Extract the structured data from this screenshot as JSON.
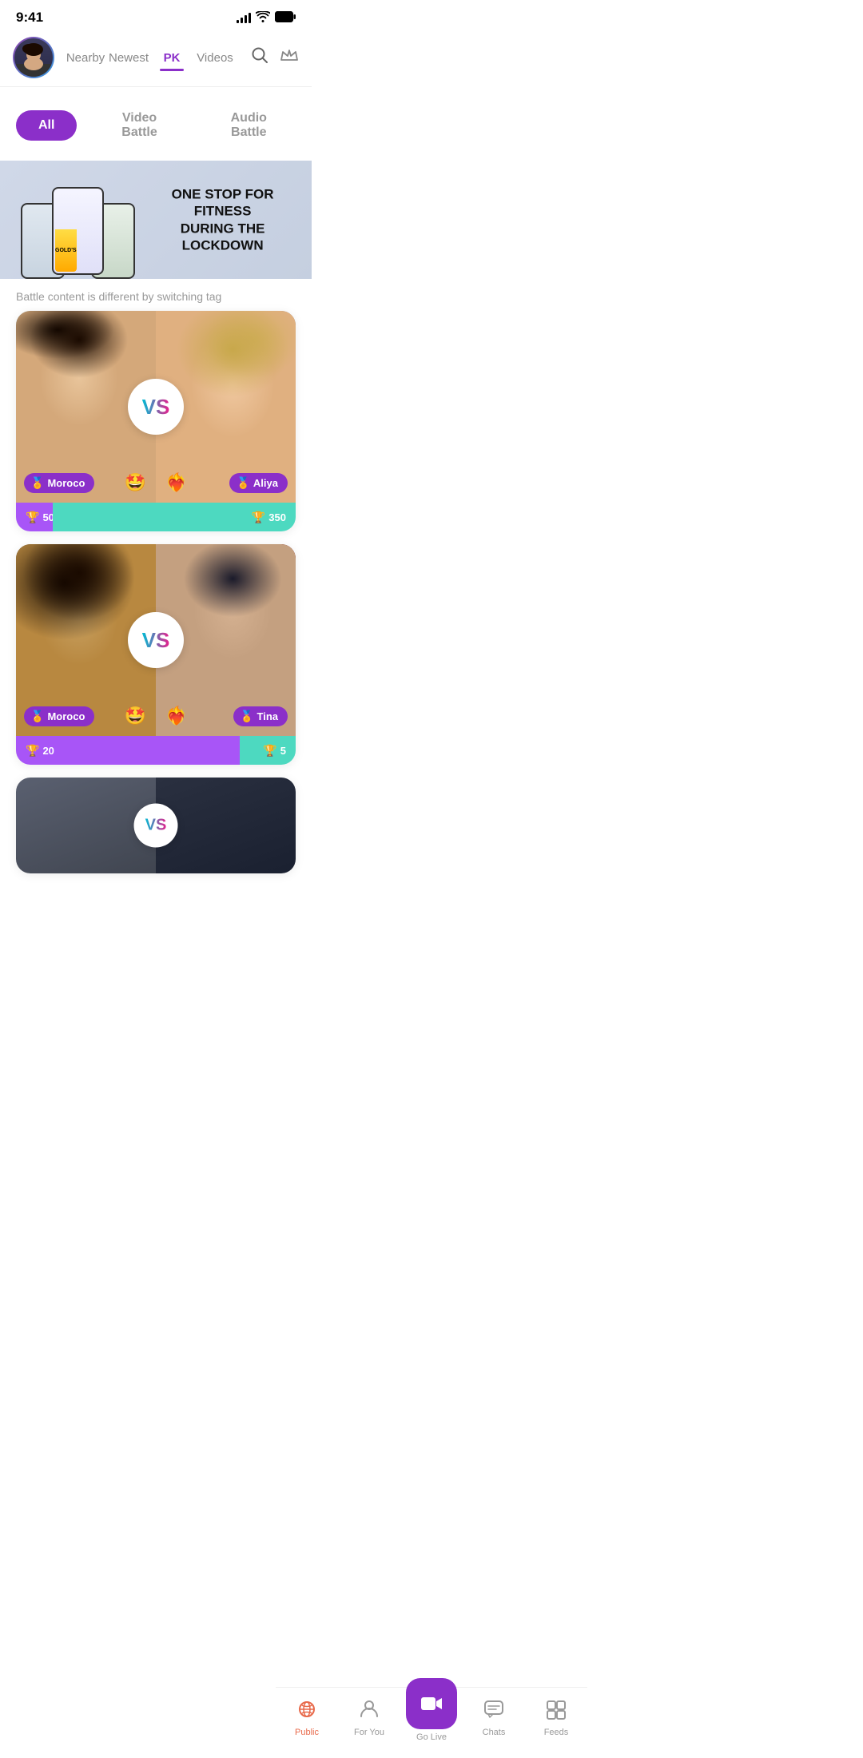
{
  "statusBar": {
    "time": "9:41"
  },
  "header": {
    "navItems": [
      {
        "id": "nearby",
        "label": "Nearby",
        "active": false
      },
      {
        "id": "newest",
        "label": "Newest",
        "active": false
      },
      {
        "id": "pk",
        "label": "PK",
        "active": true
      },
      {
        "id": "videos",
        "label": "Videos",
        "active": false
      }
    ]
  },
  "filterBar": {
    "buttons": [
      {
        "id": "all",
        "label": "All",
        "active": true
      },
      {
        "id": "video-battle",
        "label": "Video Battle",
        "active": false
      },
      {
        "id": "audio-battle",
        "label": "Audio Battle",
        "active": false
      }
    ]
  },
  "banner": {
    "text1": "ONE STOP FOR FITNESS",
    "text2": "DURING THE LOCKDOWN",
    "logoText": "GOLD'S GYM"
  },
  "battleSubtitle": "Battle content is different by switching tag",
  "battleCards": [
    {
      "id": "card1",
      "leftUser": {
        "name": "Moroco",
        "emoji": "🤩"
      },
      "rightUser": {
        "name": "Aliya",
        "emoji": "🤩"
      },
      "vsEmoji": "❤️‍🔥",
      "scoreLeft": "50",
      "scoreRight": "350",
      "progressLeft": 13
    },
    {
      "id": "card2",
      "leftUser": {
        "name": "Moroco",
        "emoji": "🤩"
      },
      "rightUser": {
        "name": "Tina",
        "emoji": "🤩"
      },
      "vsEmoji": "❤️‍🔥",
      "scoreLeft": "20",
      "scoreRight": "5",
      "progressLeft": 80
    }
  ],
  "bottomNav": {
    "tabs": [
      {
        "id": "public",
        "label": "Public",
        "active": true
      },
      {
        "id": "for-you",
        "label": "For You",
        "active": false
      },
      {
        "id": "go-live",
        "label": "Go Live",
        "active": false,
        "special": true
      },
      {
        "id": "chats",
        "label": "Chats",
        "active": false
      },
      {
        "id": "feeds",
        "label": "Feeds",
        "active": false
      }
    ]
  }
}
